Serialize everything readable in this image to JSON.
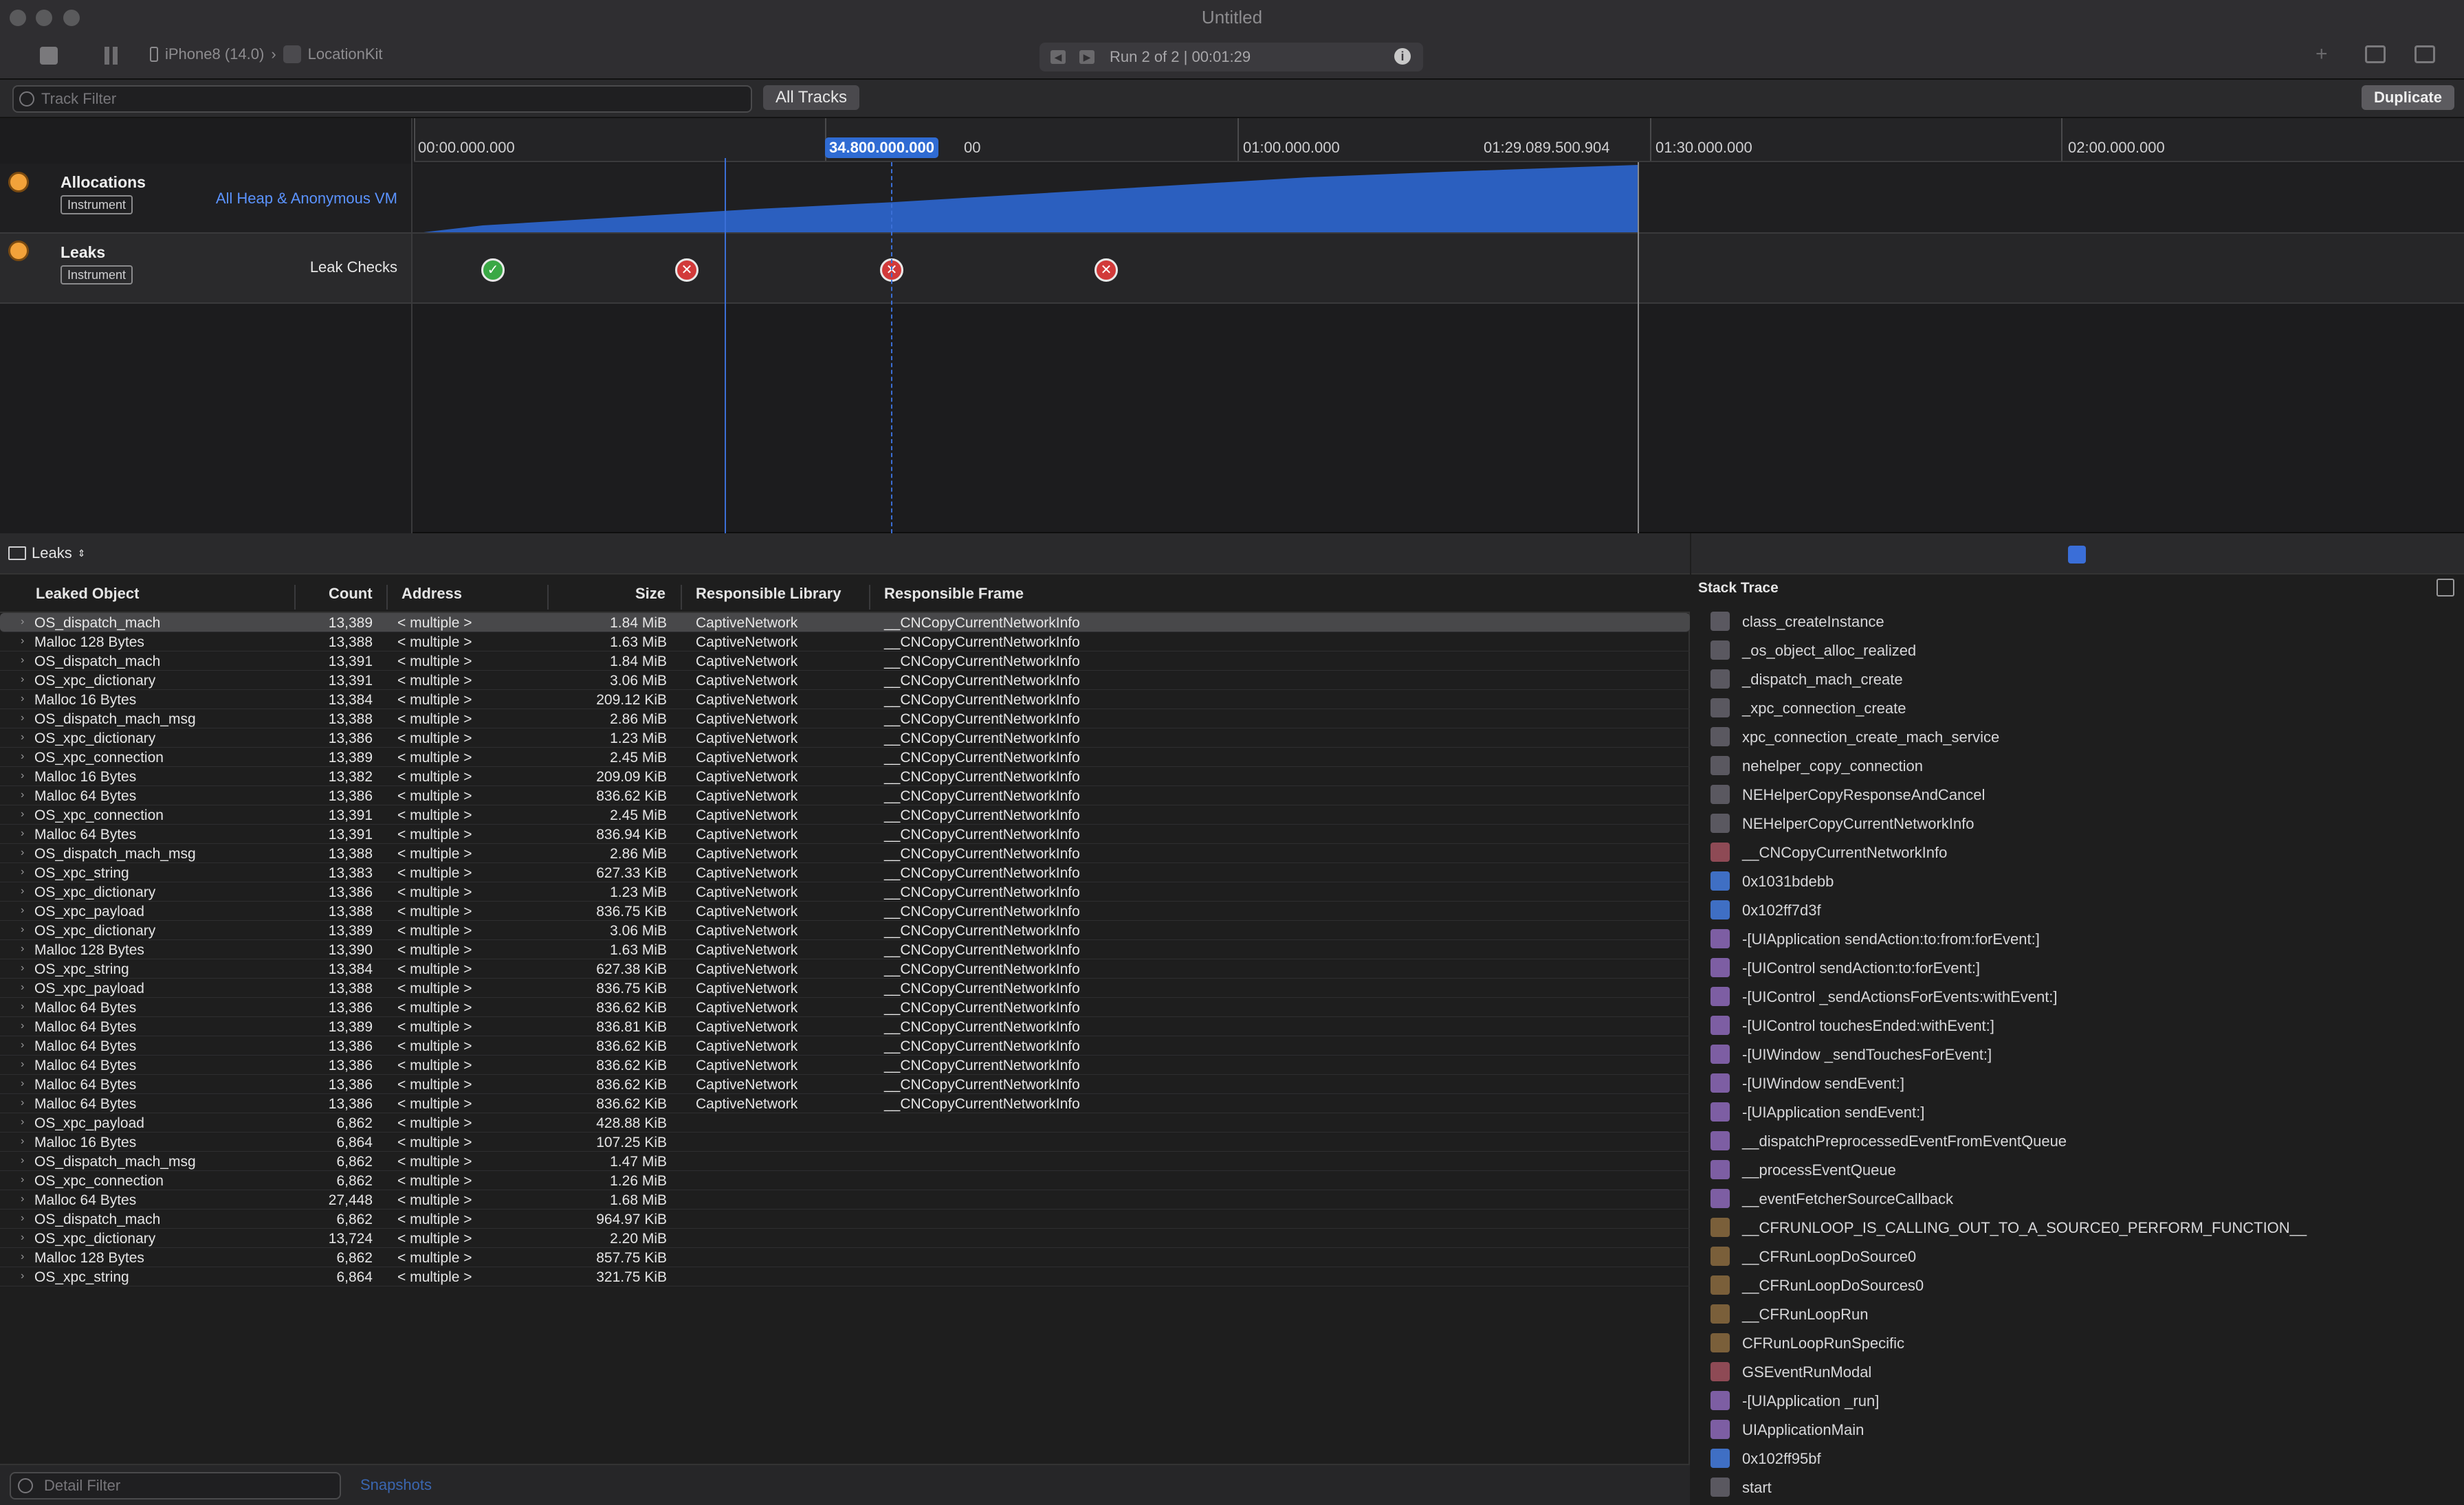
{
  "window": {
    "title": "Untitled"
  },
  "toolbar": {
    "device": "iPhone8 (14.0)",
    "app": "LocationKit",
    "run_label": "Run 2 of 2  |  00:01:29"
  },
  "filterbar": {
    "track_filter_placeholder": "Track Filter",
    "all_tracks": "All Tracks",
    "duplicate": "Duplicate"
  },
  "timeline": {
    "ticks": [
      "00:00.000.000",
      "01:00.000.000",
      "01:29.089.500.904",
      "01:30.000.000",
      "02:00.000.000"
    ],
    "playhead": "34.800.000.000",
    "playhead_suffix": "00"
  },
  "tracks": {
    "allocations": {
      "name": "Allocations",
      "badge": "Instrument",
      "sub": "All Heap & Anonymous VM"
    },
    "leaks": {
      "name": "Leaks",
      "badge": "Instrument",
      "sub": "Leak Checks"
    },
    "leak_checks": [
      "ok",
      "leak",
      "leak",
      "leak"
    ]
  },
  "detail": {
    "view": "Leaks",
    "columns": [
      "Leaked Object",
      "Count",
      "Address",
      "Size",
      "Responsible Library",
      "Responsible Frame"
    ],
    "rows": [
      [
        "OS_dispatch_mach",
        "13,389",
        "< multiple >",
        "1.84 MiB",
        "CaptiveNetwork",
        "__CNCopyCurrentNetworkInfo"
      ],
      [
        "Malloc 128 Bytes",
        "13,388",
        "< multiple >",
        "1.63 MiB",
        "CaptiveNetwork",
        "__CNCopyCurrentNetworkInfo"
      ],
      [
        "OS_dispatch_mach",
        "13,391",
        "< multiple >",
        "1.84 MiB",
        "CaptiveNetwork",
        "__CNCopyCurrentNetworkInfo"
      ],
      [
        "OS_xpc_dictionary",
        "13,391",
        "< multiple >",
        "3.06 MiB",
        "CaptiveNetwork",
        "__CNCopyCurrentNetworkInfo"
      ],
      [
        "Malloc 16 Bytes",
        "13,384",
        "< multiple >",
        "209.12 KiB",
        "CaptiveNetwork",
        "__CNCopyCurrentNetworkInfo"
      ],
      [
        "OS_dispatch_mach_msg",
        "13,388",
        "< multiple >",
        "2.86 MiB",
        "CaptiveNetwork",
        "__CNCopyCurrentNetworkInfo"
      ],
      [
        "OS_xpc_dictionary",
        "13,386",
        "< multiple >",
        "1.23 MiB",
        "CaptiveNetwork",
        "__CNCopyCurrentNetworkInfo"
      ],
      [
        "OS_xpc_connection",
        "13,389",
        "< multiple >",
        "2.45 MiB",
        "CaptiveNetwork",
        "__CNCopyCurrentNetworkInfo"
      ],
      [
        "Malloc 16 Bytes",
        "13,382",
        "< multiple >",
        "209.09 KiB",
        "CaptiveNetwork",
        "__CNCopyCurrentNetworkInfo"
      ],
      [
        "Malloc 64 Bytes",
        "13,386",
        "< multiple >",
        "836.62 KiB",
        "CaptiveNetwork",
        "__CNCopyCurrentNetworkInfo"
      ],
      [
        "OS_xpc_connection",
        "13,391",
        "< multiple >",
        "2.45 MiB",
        "CaptiveNetwork",
        "__CNCopyCurrentNetworkInfo"
      ],
      [
        "Malloc 64 Bytes",
        "13,391",
        "< multiple >",
        "836.94 KiB",
        "CaptiveNetwork",
        "__CNCopyCurrentNetworkInfo"
      ],
      [
        "OS_dispatch_mach_msg",
        "13,388",
        "< multiple >",
        "2.86 MiB",
        "CaptiveNetwork",
        "__CNCopyCurrentNetworkInfo"
      ],
      [
        "OS_xpc_string",
        "13,383",
        "< multiple >",
        "627.33 KiB",
        "CaptiveNetwork",
        "__CNCopyCurrentNetworkInfo"
      ],
      [
        "OS_xpc_dictionary",
        "13,386",
        "< multiple >",
        "1.23 MiB",
        "CaptiveNetwork",
        "__CNCopyCurrentNetworkInfo"
      ],
      [
        "OS_xpc_payload",
        "13,388",
        "< multiple >",
        "836.75 KiB",
        "CaptiveNetwork",
        "__CNCopyCurrentNetworkInfo"
      ],
      [
        "OS_xpc_dictionary",
        "13,389",
        "< multiple >",
        "3.06 MiB",
        "CaptiveNetwork",
        "__CNCopyCurrentNetworkInfo"
      ],
      [
        "Malloc 128 Bytes",
        "13,390",
        "< multiple >",
        "1.63 MiB",
        "CaptiveNetwork",
        "__CNCopyCurrentNetworkInfo"
      ],
      [
        "OS_xpc_string",
        "13,384",
        "< multiple >",
        "627.38 KiB",
        "CaptiveNetwork",
        "__CNCopyCurrentNetworkInfo"
      ],
      [
        "OS_xpc_payload",
        "13,388",
        "< multiple >",
        "836.75 KiB",
        "CaptiveNetwork",
        "__CNCopyCurrentNetworkInfo"
      ],
      [
        "Malloc 64 Bytes",
        "13,386",
        "< multiple >",
        "836.62 KiB",
        "CaptiveNetwork",
        "__CNCopyCurrentNetworkInfo"
      ],
      [
        "Malloc 64 Bytes",
        "13,389",
        "< multiple >",
        "836.81 KiB",
        "CaptiveNetwork",
        "__CNCopyCurrentNetworkInfo"
      ],
      [
        "Malloc 64 Bytes",
        "13,386",
        "< multiple >",
        "836.62 KiB",
        "CaptiveNetwork",
        "__CNCopyCurrentNetworkInfo"
      ],
      [
        "Malloc 64 Bytes",
        "13,386",
        "< multiple >",
        "836.62 KiB",
        "CaptiveNetwork",
        "__CNCopyCurrentNetworkInfo"
      ],
      [
        "Malloc 64 Bytes",
        "13,386",
        "< multiple >",
        "836.62 KiB",
        "CaptiveNetwork",
        "__CNCopyCurrentNetworkInfo"
      ],
      [
        "Malloc 64 Bytes",
        "13,386",
        "< multiple >",
        "836.62 KiB",
        "CaptiveNetwork",
        "__CNCopyCurrentNetworkInfo"
      ],
      [
        "OS_xpc_payload",
        "6,862",
        "< multiple >",
        "428.88 KiB",
        "",
        ""
      ],
      [
        "Malloc 16 Bytes",
        "6,864",
        "< multiple >",
        "107.25 KiB",
        "",
        ""
      ],
      [
        "OS_dispatch_mach_msg",
        "6,862",
        "< multiple >",
        "1.47 MiB",
        "",
        ""
      ],
      [
        "OS_xpc_connection",
        "6,862",
        "< multiple >",
        "1.26 MiB",
        "",
        ""
      ],
      [
        "Malloc 64 Bytes",
        "27,448",
        "< multiple >",
        "1.68 MiB",
        "",
        ""
      ],
      [
        "OS_dispatch_mach",
        "6,862",
        "< multiple >",
        "964.97 KiB",
        "",
        ""
      ],
      [
        "OS_xpc_dictionary",
        "13,724",
        "< multiple >",
        "2.20 MiB",
        "",
        ""
      ],
      [
        "Malloc 128 Bytes",
        "6,862",
        "< multiple >",
        "857.75 KiB",
        "",
        ""
      ],
      [
        "OS_xpc_string",
        "6,864",
        "< multiple >",
        "321.75 KiB",
        "",
        ""
      ]
    ],
    "detail_filter_placeholder": "Detail Filter",
    "snapshots": "Snapshots"
  },
  "stack": {
    "title": "Stack Trace",
    "frames": [
      {
        "t": "class_createInstance",
        "k": "sys"
      },
      {
        "t": "_os_object_alloc_realized",
        "k": "sys"
      },
      {
        "t": "_dispatch_mach_create",
        "k": "sys"
      },
      {
        "t": "_xpc_connection_create",
        "k": "sys"
      },
      {
        "t": "xpc_connection_create_mach_service",
        "k": "sys"
      },
      {
        "t": "nehelper_copy_connection",
        "k": "sys"
      },
      {
        "t": "NEHelperCopyResponseAndCancel",
        "k": "sys"
      },
      {
        "t": "NEHelperCopyCurrentNetworkInfo",
        "k": "sys"
      },
      {
        "t": "__CNCopyCurrentNetworkInfo",
        "k": "red"
      },
      {
        "t": "0x1031bdebb",
        "k": "user"
      },
      {
        "t": "0x102ff7d3f",
        "k": "user"
      },
      {
        "t": "-[UIApplication sendAction:to:from:forEvent:]",
        "k": "uikit"
      },
      {
        "t": "-[UIControl sendAction:to:forEvent:]",
        "k": "uikit"
      },
      {
        "t": "-[UIControl _sendActionsForEvents:withEvent:]",
        "k": "uikit"
      },
      {
        "t": "-[UIControl touchesEnded:withEvent:]",
        "k": "uikit"
      },
      {
        "t": "-[UIWindow _sendTouchesForEvent:]",
        "k": "uikit"
      },
      {
        "t": "-[UIWindow sendEvent:]",
        "k": "uikit"
      },
      {
        "t": "-[UIApplication sendEvent:]",
        "k": "uikit"
      },
      {
        "t": "__dispatchPreprocessedEventFromEventQueue",
        "k": "uikit"
      },
      {
        "t": "__processEventQueue",
        "k": "uikit"
      },
      {
        "t": "__eventFetcherSourceCallback",
        "k": "uikit"
      },
      {
        "t": "__CFRUNLOOP_IS_CALLING_OUT_TO_A_SOURCE0_PERFORM_FUNCTION__",
        "k": "cf"
      },
      {
        "t": "__CFRunLoopDoSource0",
        "k": "cf"
      },
      {
        "t": "__CFRunLoopDoSources0",
        "k": "cf"
      },
      {
        "t": "__CFRunLoopRun",
        "k": "cf"
      },
      {
        "t": "CFRunLoopRunSpecific",
        "k": "cf"
      },
      {
        "t": "GSEventRunModal",
        "k": "red"
      },
      {
        "t": "-[UIApplication _run]",
        "k": "uikit"
      },
      {
        "t": "UIApplicationMain",
        "k": "uikit"
      },
      {
        "t": "0x102ff95bf",
        "k": "user"
      },
      {
        "t": "start",
        "k": "sys"
      }
    ]
  }
}
